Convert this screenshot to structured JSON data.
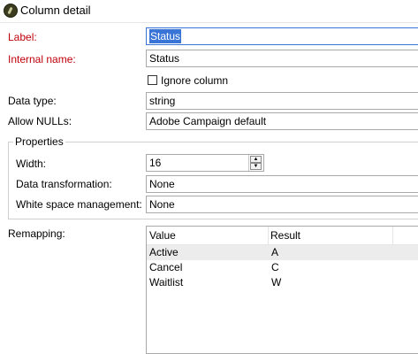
{
  "window": {
    "title": "Column detail",
    "icon": "adobe-campaign-app-icon"
  },
  "form": {
    "label": {
      "caption": "Label:",
      "value": "Status",
      "color": "#c0000a"
    },
    "internal_name": {
      "caption": "Internal name:",
      "value": "Status",
      "color": "#c0000a"
    },
    "ignore_column": {
      "caption": "Ignore column",
      "checked": false
    },
    "data_type": {
      "caption": "Data type:",
      "value": "string"
    },
    "allow_nulls": {
      "caption": "Allow NULLs:",
      "value": "Adobe Campaign default"
    }
  },
  "properties": {
    "legend": "Properties",
    "width": {
      "caption": "Width:",
      "value": "16"
    },
    "data_transformation": {
      "caption": "Data transformation:",
      "value": "None"
    },
    "white_space": {
      "caption": "White space management:",
      "value": "None"
    }
  },
  "remapping": {
    "caption": "Remapping:",
    "columns": [
      "Value",
      "Result"
    ],
    "rows": [
      {
        "value": "Active",
        "result": "A",
        "selected": true
      },
      {
        "value": "Cancel",
        "result": "C",
        "selected": false
      },
      {
        "value": "Waitlist",
        "result": "W",
        "selected": false
      }
    ]
  },
  "colors": {
    "selection": "#3875d7",
    "required_label": "#c0000a"
  }
}
